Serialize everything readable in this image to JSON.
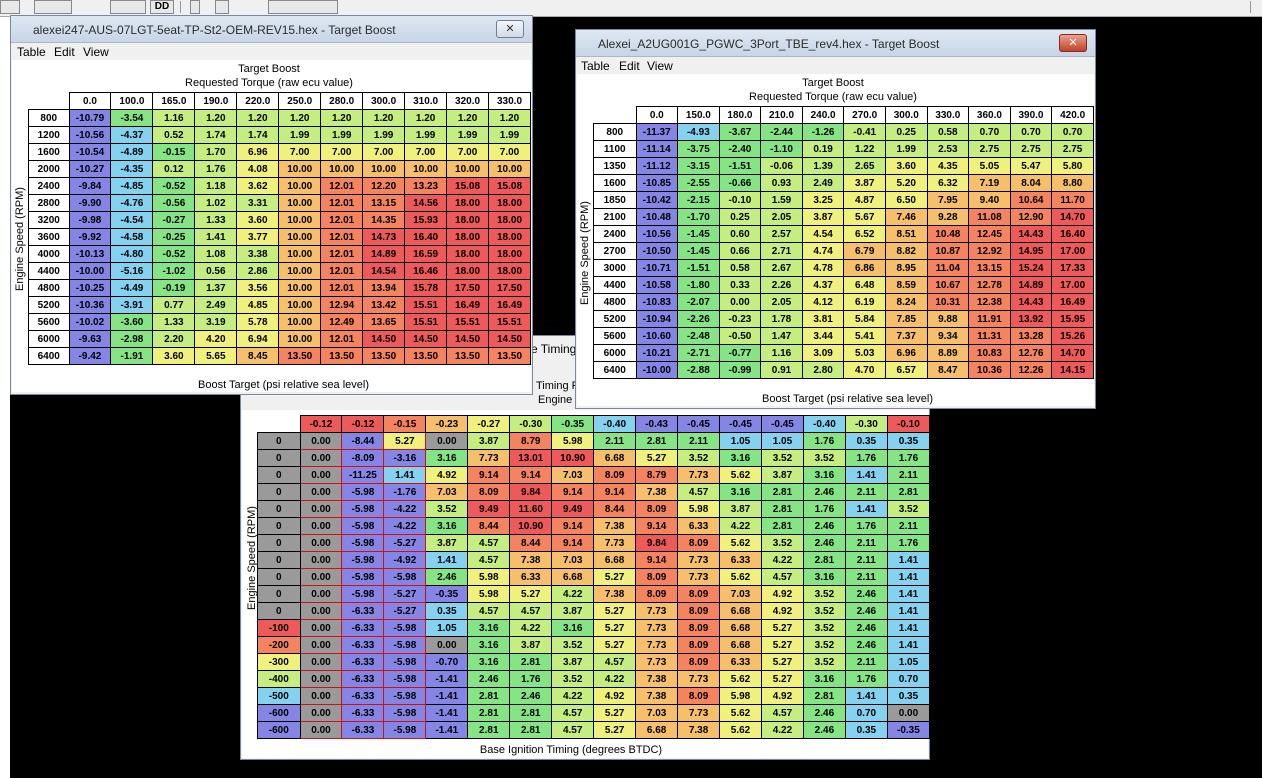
{
  "palette": [
    "#8585e5",
    "#85d2f0",
    "#85e585",
    "#c5ed7f",
    "#f0f07d",
    "#f5bf6b",
    "#f3845f",
    "#ee5a5a"
  ],
  "grey": "#9a9a9a",
  "toolbar": {
    "btn1": "DD"
  },
  "win1": {
    "title": "alexei247-AUS-07LGT-5eat-TP-St2-OEM-REV15.hex - Target Boost",
    "close": "✕",
    "menu": [
      "Table",
      "Edit",
      "View"
    ],
    "header1": "Target Boost",
    "header2": "Requested Torque (raw ecu value)",
    "ylabel": "Engine Speed (RPM)",
    "footer": "Boost Target (psi relative sea level)",
    "cols": [
      "0.0",
      "100.0",
      "165.0",
      "190.0",
      "220.0",
      "250.0",
      "280.0",
      "300.0",
      "310.0",
      "320.0",
      "330.0"
    ],
    "rows": [
      "800",
      "1200",
      "1600",
      "2000",
      "2400",
      "2800",
      "3200",
      "3600",
      "4000",
      "4400",
      "4800",
      "5200",
      "5600",
      "6000",
      "6400"
    ],
    "scale": [
      -11.0,
      18.0
    ],
    "values": [
      [
        "-10.79",
        "-3.54",
        "1.16",
        "1.20",
        "1.20",
        "1.20",
        "1.20",
        "1.20",
        "1.20",
        "1.20",
        "1.20"
      ],
      [
        "-10.56",
        "-4.37",
        "0.52",
        "1.74",
        "1.74",
        "1.99",
        "1.99",
        "1.99",
        "1.99",
        "1.99",
        "1.99"
      ],
      [
        "-10.54",
        "-4.89",
        "-0.15",
        "1.70",
        "6.96",
        "7.00",
        "7.00",
        "7.00",
        "7.00",
        "7.00",
        "7.00"
      ],
      [
        "-10.27",
        "-4.35",
        "0.12",
        "1.76",
        "4.08",
        "10.00",
        "10.00",
        "10.00",
        "10.00",
        "10.00",
        "10.00"
      ],
      [
        "-9.84",
        "-4.85",
        "-0.52",
        "1.18",
        "3.62",
        "10.00",
        "12.01",
        "12.20",
        "13.23",
        "15.08",
        "15.08"
      ],
      [
        "-9.90",
        "-4.76",
        "-0.56",
        "1.02",
        "3.31",
        "10.00",
        "12.01",
        "13.15",
        "14.56",
        "18.00",
        "18.00"
      ],
      [
        "-9.98",
        "-4.54",
        "-0.27",
        "1.33",
        "3.60",
        "10.00",
        "12.01",
        "14.35",
        "15.93",
        "18.00",
        "18.00"
      ],
      [
        "-9.92",
        "-4.58",
        "-0.25",
        "1.41",
        "3.77",
        "10.00",
        "12.01",
        "14.73",
        "16.40",
        "18.00",
        "18.00"
      ],
      [
        "-10.13",
        "-4.80",
        "-0.52",
        "1.08",
        "3.38",
        "10.00",
        "12.01",
        "14.89",
        "16.59",
        "18.00",
        "18.00"
      ],
      [
        "-10.00",
        "-5.16",
        "-1.02",
        "0.56",
        "2.86",
        "10.00",
        "12.01",
        "14.54",
        "16.46",
        "18.00",
        "18.00"
      ],
      [
        "-10.25",
        "-4.49",
        "-0.19",
        "1.37",
        "3.56",
        "10.00",
        "12.01",
        "13.94",
        "15.78",
        "17.50",
        "17.50"
      ],
      [
        "-10.36",
        "-3.91",
        "0.77",
        "2.49",
        "4.85",
        "10.00",
        "12.94",
        "13.42",
        "15.51",
        "16.49",
        "16.49"
      ],
      [
        "-10.02",
        "-3.60",
        "1.33",
        "3.19",
        "5.78",
        "10.00",
        "12.49",
        "13.65",
        "15.51",
        "15.51",
        "15.51"
      ],
      [
        "-9.63",
        "-2.98",
        "2.20",
        "4.20",
        "6.94",
        "10.00",
        "12.01",
        "14.50",
        "14.50",
        "14.50",
        "14.50"
      ],
      [
        "-9.42",
        "-1.91",
        "3.60",
        "5.65",
        "8.45",
        "13.50",
        "13.50",
        "13.50",
        "13.50",
        "13.50",
        "13.50"
      ]
    ]
  },
  "win2": {
    "title": "Alexei_A2UG001G_PGWC_3Port_TBE_rev4.hex - Target Boost",
    "close": "✕",
    "menu": [
      "Table",
      "Edit",
      "View"
    ],
    "header1": "Target Boost",
    "header2": "Requested Torque (raw ecu value)",
    "ylabel": "Engine Speed (RPM)",
    "footer": "Boost Target (psi relative sea level)",
    "cols": [
      "0.0",
      "150.0",
      "180.0",
      "210.0",
      "240.0",
      "270.0",
      "300.0",
      "330.0",
      "360.0",
      "390.0",
      "420.0"
    ],
    "rows": [
      "800",
      "1100",
      "1350",
      "1600",
      "1850",
      "2100",
      "2400",
      "2700",
      "3000",
      "4400",
      "4800",
      "5200",
      "5600",
      "6000",
      "6400"
    ],
    "scale": [
      -11.4,
      17.4
    ],
    "values": [
      [
        "-11.37",
        "-4.93",
        "-3.67",
        "-2.44",
        "-1.26",
        "-0.41",
        "0.25",
        "0.58",
        "0.70",
        "0.70",
        "0.70"
      ],
      [
        "-11.14",
        "-3.75",
        "-2.40",
        "-1.10",
        "0.19",
        "1.22",
        "1.99",
        "2.53",
        "2.75",
        "2.75",
        "2.75"
      ],
      [
        "-11.12",
        "-3.15",
        "-1.51",
        "-0.06",
        "1.39",
        "2.65",
        "3.60",
        "4.35",
        "5.05",
        "5.47",
        "5.80"
      ],
      [
        "-10.85",
        "-2.55",
        "-0.66",
        "0.93",
        "2.49",
        "3.87",
        "5.20",
        "6.32",
        "7.19",
        "8.04",
        "8.80"
      ],
      [
        "-10.42",
        "-2.15",
        "-0.10",
        "1.59",
        "3.25",
        "4.87",
        "6.50",
        "7.95",
        "9.40",
        "10.64",
        "11.70"
      ],
      [
        "-10.48",
        "-1.70",
        "0.25",
        "2.05",
        "3.87",
        "5.67",
        "7.46",
        "9.28",
        "11.08",
        "12.90",
        "14.70"
      ],
      [
        "-10.56",
        "-1.45",
        "0.60",
        "2.57",
        "4.54",
        "6.52",
        "8.51",
        "10.48",
        "12.45",
        "14.43",
        "16.40"
      ],
      [
        "-10.50",
        "-1.45",
        "0.66",
        "2.71",
        "4.74",
        "6.79",
        "8.82",
        "10.87",
        "12.92",
        "14.95",
        "17.00"
      ],
      [
        "-10.71",
        "-1.51",
        "0.58",
        "2.67",
        "4.78",
        "6.86",
        "8.95",
        "11.04",
        "13.15",
        "15.24",
        "17.33"
      ],
      [
        "-10.58",
        "-1.80",
        "0.33",
        "2.26",
        "4.37",
        "6.48",
        "8.59",
        "10.67",
        "12.78",
        "14.89",
        "17.00"
      ],
      [
        "-10.83",
        "-2.07",
        "0.00",
        "2.05",
        "4.12",
        "6.19",
        "8.24",
        "10.31",
        "12.38",
        "14.43",
        "16.49"
      ],
      [
        "-10.94",
        "-2.26",
        "-0.23",
        "1.78",
        "3.81",
        "5.84",
        "7.85",
        "9.88",
        "11.91",
        "13.92",
        "15.95"
      ],
      [
        "-10.60",
        "-2.48",
        "-0.50",
        "1.47",
        "3.44",
        "5.41",
        "7.37",
        "9.34",
        "11.31",
        "13.28",
        "15.26"
      ],
      [
        "-10.21",
        "-2.71",
        "-0.77",
        "1.16",
        "3.09",
        "5.03",
        "6.96",
        "8.89",
        "10.83",
        "12.76",
        "14.70"
      ],
      [
        "-10.00",
        "-2.88",
        "-0.99",
        "0.91",
        "2.80",
        "4.70",
        "6.57",
        "8.47",
        "10.36",
        "12.26",
        "14.15"
      ]
    ]
  },
  "win3": {
    "title_partial": "e Timing",
    "header_partial": "Timing P",
    "header_partial2": "Engine I",
    "ylabel": "Engine Speed (RPM)",
    "footer": "Base Ignition Timing (degrees BTDC)",
    "scale": [
      -1.5,
      11.0
    ],
    "cols": [
      "-0.12",
      "-0.12",
      "-0.15",
      "-0.23",
      "-0.27",
      "-0.30",
      "-0.35",
      "-0.40",
      "-0.43",
      "-0.45",
      "-0.45",
      "-0.45",
      "-0.40",
      "-0.30",
      "-0.10"
    ],
    "rows": [
      "0",
      "0",
      "0",
      "0",
      "0",
      "0",
      "0",
      "0",
      "0",
      "0",
      "0",
      "-100",
      "-200",
      "-300",
      "-400",
      "-500",
      "-600",
      "-600"
    ],
    "values": [
      [
        "0.00",
        "-8.44",
        "5.27",
        "0.00",
        "3.87",
        "8.79",
        "5.98",
        "2.11",
        "2.81",
        "2.11",
        "1.05",
        "1.05",
        "1.76",
        "0.35",
        "0.35"
      ],
      [
        "0.00",
        "-8.09",
        "-3.16",
        "3.16",
        "7.73",
        "13.01",
        "10.90",
        "6.68",
        "5.27",
        "3.52",
        "3.16",
        "3.52",
        "3.52",
        "1.76",
        "1.76"
      ],
      [
        "0.00",
        "-11.25",
        "1.41",
        "4.92",
        "9.14",
        "9.14",
        "7.03",
        "8.09",
        "8.79",
        "7.73",
        "5.62",
        "3.87",
        "3.16",
        "1.41",
        "2.11"
      ],
      [
        "0.00",
        "-5.98",
        "-1.76",
        "7.03",
        "8.09",
        "9.84",
        "9.14",
        "9.14",
        "7.38",
        "4.57",
        "3.16",
        "2.81",
        "2.46",
        "2.11",
        "2.81"
      ],
      [
        "0.00",
        "-5.98",
        "-4.22",
        "3.52",
        "9.49",
        "11.60",
        "9.49",
        "8.44",
        "8.09",
        "5.98",
        "3.87",
        "2.81",
        "1.76",
        "1.41",
        "3.52"
      ],
      [
        "0.00",
        "-5.98",
        "-4.22",
        "3.16",
        "8.44",
        "10.90",
        "9.14",
        "7.38",
        "9.14",
        "6.33",
        "4.22",
        "2.81",
        "2.46",
        "1.76",
        "2.11"
      ],
      [
        "0.00",
        "-5.98",
        "-5.27",
        "3.87",
        "4.57",
        "8.44",
        "9.14",
        "7.73",
        "9.84",
        "8.09",
        "5.62",
        "3.52",
        "2.46",
        "2.11",
        "1.76"
      ],
      [
        "0.00",
        "-5.98",
        "-4.92",
        "1.41",
        "4.57",
        "7.38",
        "7.03",
        "6.68",
        "9.14",
        "7.73",
        "6.33",
        "4.22",
        "2.81",
        "2.11",
        "1.41"
      ],
      [
        "0.00",
        "-5.98",
        "-5.98",
        "2.46",
        "5.98",
        "6.33",
        "6.68",
        "5.27",
        "8.09",
        "7.73",
        "5.62",
        "4.57",
        "3.16",
        "2.11",
        "1.41"
      ],
      [
        "0.00",
        "-5.98",
        "-5.27",
        "-0.35",
        "5.98",
        "5.27",
        "4.22",
        "7.38",
        "8.09",
        "8.09",
        "7.03",
        "4.92",
        "3.52",
        "2.46",
        "1.41"
      ],
      [
        "0.00",
        "-6.33",
        "-5.27",
        "0.35",
        "4.57",
        "4.57",
        "3.87",
        "5.27",
        "7.73",
        "8.09",
        "6.68",
        "4.92",
        "3.52",
        "2.46",
        "1.41"
      ],
      [
        "0.00",
        "-6.33",
        "-5.98",
        "1.05",
        "3.16",
        "4.22",
        "3.16",
        "5.27",
        "7.73",
        "8.09",
        "6.68",
        "5.27",
        "3.52",
        "2.46",
        "1.41"
      ],
      [
        "0.00",
        "-6.33",
        "-5.98",
        "0.00",
        "3.16",
        "3.87",
        "3.52",
        "5.27",
        "7.73",
        "8.09",
        "6.68",
        "5.27",
        "3.52",
        "2.46",
        "1.41"
      ],
      [
        "0.00",
        "-6.33",
        "-5.98",
        "-0.70",
        "3.16",
        "2.81",
        "3.87",
        "4.57",
        "7.73",
        "8.09",
        "6.33",
        "5.27",
        "3.52",
        "2.11",
        "1.05"
      ],
      [
        "0.00",
        "-6.33",
        "-5.98",
        "-1.41",
        "2.46",
        "1.76",
        "3.52",
        "4.22",
        "7.38",
        "7.73",
        "5.62",
        "5.27",
        "3.16",
        "1.76",
        "0.70"
      ],
      [
        "0.00",
        "-6.33",
        "-5.98",
        "-1.41",
        "2.81",
        "2.46",
        "4.22",
        "4.92",
        "7.38",
        "8.09",
        "5.98",
        "4.92",
        "2.81",
        "1.41",
        "0.35"
      ],
      [
        "0.00",
        "-6.33",
        "-5.98",
        "-1.41",
        "2.81",
        "2.81",
        "4.57",
        "5.27",
        "7.03",
        "7.73",
        "5.62",
        "4.57",
        "2.46",
        "0.70",
        "0.00"
      ],
      [
        "0.00",
        "-6.33",
        "-5.98",
        "-1.41",
        "2.81",
        "2.81",
        "4.57",
        "5.27",
        "6.68",
        "7.38",
        "5.62",
        "4.22",
        "2.46",
        "0.35",
        "-0.35"
      ]
    ]
  }
}
